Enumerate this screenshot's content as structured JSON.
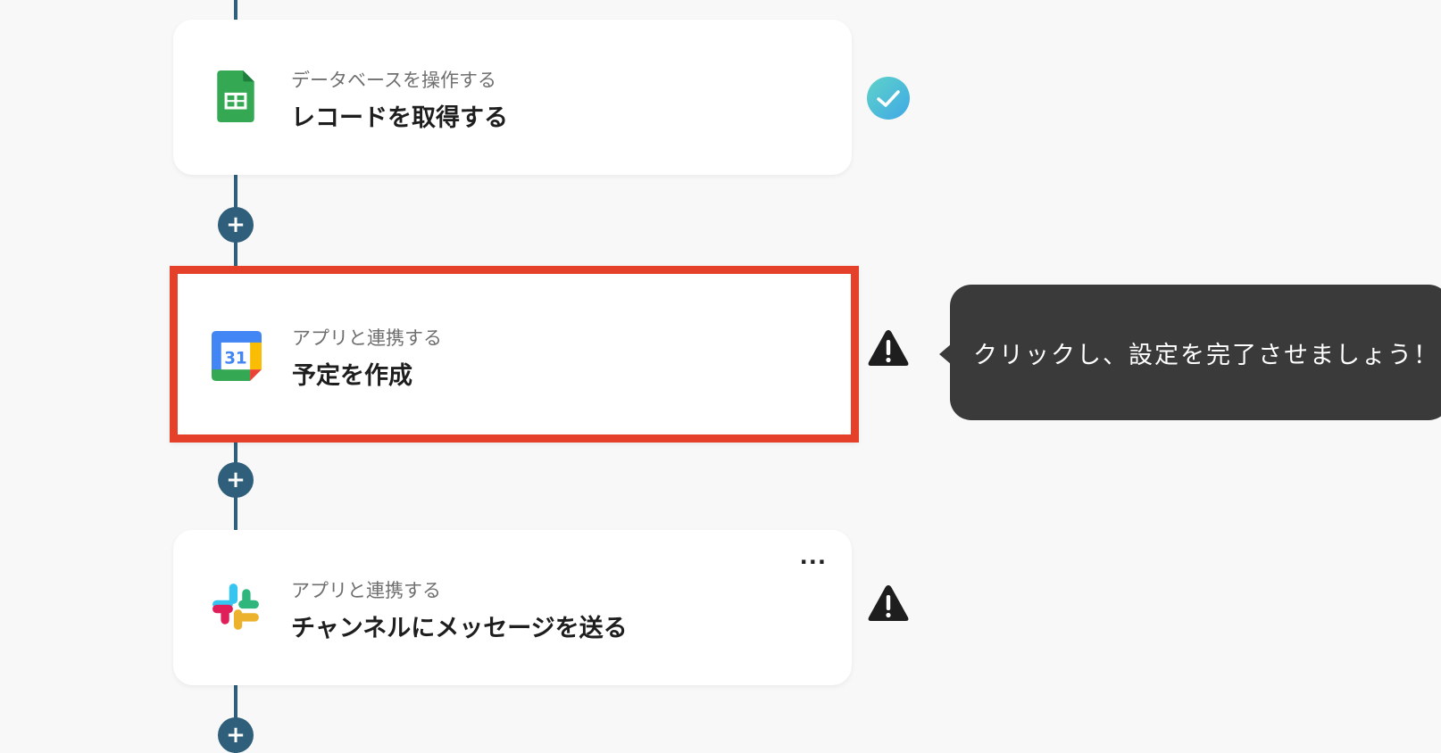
{
  "flow": {
    "steps": [
      {
        "subtitle": "データベースを操作する",
        "title": "レコードを取得する",
        "app_icon": "google-sheets-icon",
        "status": "done"
      },
      {
        "subtitle": "アプリと連携する",
        "title": "予定を作成",
        "app_icon": "google-calendar-icon",
        "calendar_day": "31",
        "status": "warning",
        "selected": true
      },
      {
        "subtitle": "アプリと連携する",
        "title": "チャンネルにメッセージを送る",
        "app_icon": "slack-icon",
        "status": "warning",
        "more_label": "···"
      }
    ],
    "add_step_label": "+"
  },
  "tooltip": {
    "text": "クリックし、設定を完了させましょう！"
  },
  "colors": {
    "connector": "#2f5f7a",
    "highlight": "#e4402a",
    "check": "#46bfe0",
    "tooltip_bg": "#3a3a3a"
  }
}
